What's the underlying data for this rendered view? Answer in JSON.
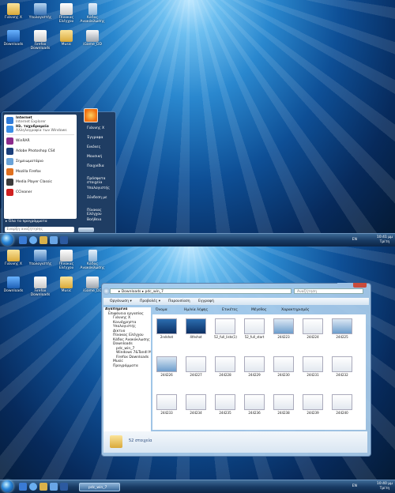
{
  "desktop_top": {
    "icons": [
      {
        "label": "Γιάννης Χ",
        "icon": "folder-icon",
        "glyph": "g-folder"
      },
      {
        "label": "Υπολογιστής",
        "icon": "computer-icon",
        "glyph": "g-comp"
      },
      {
        "label": "Πίνακας Ελέγχου",
        "icon": "documents-icon",
        "glyph": "g-docs"
      },
      {
        "label": "Κάδος Ανακύκλωσης",
        "icon": "recycle-bin-icon",
        "glyph": "g-trash"
      },
      {
        "label": "Downloads",
        "icon": "downloads-icon",
        "glyph": "g-down"
      },
      {
        "label": "Firefox Downloads",
        "icon": "firefox-downloads-icon",
        "glyph": "g-docs"
      },
      {
        "label": "Music",
        "icon": "music-folder-icon",
        "glyph": "g-folder"
      },
      {
        "label": "iGame_DD",
        "icon": "printer-icon",
        "glyph": "g-printer"
      }
    ]
  },
  "start_menu": {
    "pinned": [
      {
        "title": "Internet",
        "subtitle": "Internet Explorer",
        "color": "#2f7bd8"
      },
      {
        "title": "Ηλ. ταχυδρομείο",
        "subtitle": "Αλληλογραφία των Windows",
        "color": "#3a8ee6"
      }
    ],
    "recent": [
      {
        "title": "WinRAR",
        "color": "#8c2a8c"
      },
      {
        "title": "Adobe Photoshop CS4",
        "color": "#1b3f7a"
      },
      {
        "title": "Σημειωματάριο",
        "color": "#6aa3d8"
      },
      {
        "title": "Mozilla Firefox",
        "color": "#e07020"
      },
      {
        "title": "Media Player Classic",
        "color": "#3b3b3b"
      },
      {
        "title": "CCleaner",
        "color": "#d02020"
      }
    ],
    "all_programs": "Όλα τα προγράμματα",
    "search_placeholder": "Έναρξη αναζήτησης",
    "right_items": [
      "Γιάννης Χ",
      "Έγγραφα",
      "Εικόνες",
      "Μουσική",
      "Παιχνίδια",
      "Πρόσφατα στοιχεία",
      "Υπολογιστής",
      "Σύνδεση με",
      "Πίνακας Ελέγχου",
      "Βοήθεια"
    ]
  },
  "taskbar_top": {
    "lang": "EN",
    "time": "10:41 μμ",
    "day": "Τρίτη"
  },
  "desktop_bottom": {
    "icons": [
      {
        "label": "Γιάννης Χ",
        "icon": "folder-icon",
        "glyph": "g-folder"
      },
      {
        "label": "Υπολογιστής",
        "icon": "computer-icon",
        "glyph": "g-comp"
      },
      {
        "label": "Πίνακας Ελέγχου",
        "icon": "documents-icon",
        "glyph": "g-docs"
      },
      {
        "label": "Κάδος Ανακύκλωσης",
        "icon": "recycle-bin-icon",
        "glyph": "g-trash"
      },
      {
        "label": "Downloads",
        "icon": "downloads-icon",
        "glyph": "g-down"
      },
      {
        "label": "Firefox Downloads",
        "icon": "firefox-downloads-icon",
        "glyph": "g-docs"
      },
      {
        "label": "Music",
        "icon": "music-folder-icon",
        "glyph": "g-folder"
      },
      {
        "label": "iGame_DD",
        "icon": "printer-icon",
        "glyph": "g-printer"
      }
    ]
  },
  "explorer": {
    "breadcrumb": "▸ Downloads ▸ pdc_win_7",
    "search_placeholder": "Αναζήτηση",
    "commands": [
      "Οργάνωση ▾",
      "Προβολές ▾",
      "Παρουσίαση",
      "Εγγραφή"
    ],
    "columns": [
      "Όνομα",
      "Ημ/νία λήψης",
      "Ετικέτες",
      "Μέγεθος",
      "Χαρακτηρισμός"
    ],
    "nav": [
      "Αγαπημένα",
      "Επιφάνεια εργασίας",
      "Γιάννης Χ",
      "Κοινόχρηστα",
      "Υπολογιστής",
      "Δίκτυο",
      "Πίνακας Ελέγχου",
      "Κάδος Ανακύκλωσης",
      "Downloads",
      "pdc_win_7",
      "Windows 7&Tandl M3Pa",
      "Firefox Downloads",
      "Music",
      "Προγράμματα"
    ],
    "files": [
      {
        "name": "2ndshot",
        "style": "blue"
      },
      {
        "name": "4thshot",
        "style": "blue"
      },
      {
        "name": "52_full_lists(1)",
        "style": "light"
      },
      {
        "name": "52_full_start",
        "style": "light"
      },
      {
        "name": "244223",
        "style": ""
      },
      {
        "name": "244224",
        "style": "light"
      },
      {
        "name": "244225",
        "style": ""
      },
      {
        "name": "244226",
        "style": ""
      },
      {
        "name": "244227",
        "style": "light"
      },
      {
        "name": "244228",
        "style": "light"
      },
      {
        "name": "244229",
        "style": "light"
      },
      {
        "name": "244230",
        "style": "light"
      },
      {
        "name": "244231",
        "style": "light"
      },
      {
        "name": "244232",
        "style": "light"
      },
      {
        "name": "244233",
        "style": "light"
      },
      {
        "name": "244234",
        "style": "light"
      },
      {
        "name": "244235",
        "style": "light"
      },
      {
        "name": "244236",
        "style": "light"
      },
      {
        "name": "244238",
        "style": "light"
      },
      {
        "name": "244239",
        "style": "light"
      },
      {
        "name": "244240",
        "style": "light"
      }
    ],
    "item_count": "52 στοιχεία"
  },
  "taskbar_bottom": {
    "lang": "EN",
    "time": "10:40 μμ",
    "day": "Τρίτη",
    "active_window": "pdc_win_7"
  }
}
